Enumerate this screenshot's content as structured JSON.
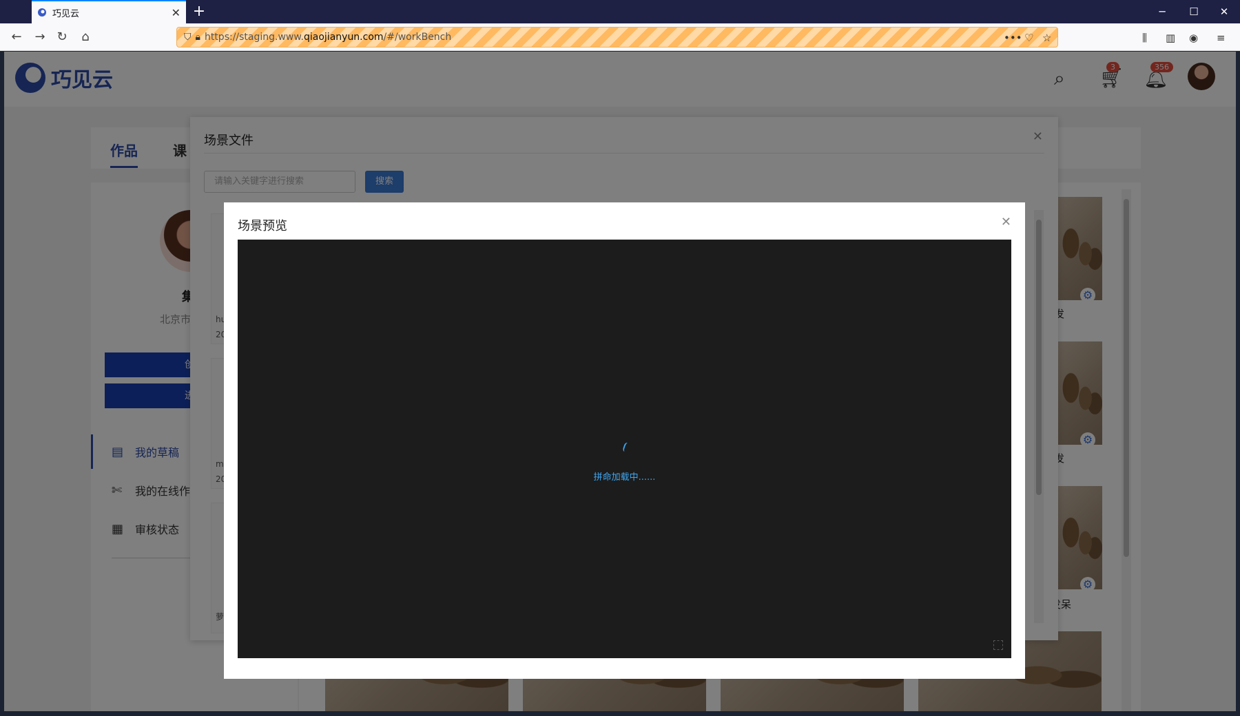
{
  "browser": {
    "tab_title": "巧见云",
    "new_tab": "+",
    "url_prefix": "https://staging.www.",
    "url_domain": "qiaojianyun.com",
    "url_path": "/#/workBench",
    "window_min": "─",
    "window_max": "☐",
    "window_close": "✕"
  },
  "app": {
    "logo_text": "巧见云",
    "cart_badge": "3",
    "bell_badge": "356",
    "tabs": {
      "works": "作品",
      "course": "课"
    },
    "profile": {
      "name": "集",
      "city": "北京市"
    },
    "buttons": {
      "create": "创作",
      "enter": "进入"
    },
    "menu": [
      {
        "label": "我的草稿"
      },
      {
        "label": "我的在线作品"
      },
      {
        "label": "审核状态"
      }
    ],
    "captions": [
      "发",
      "发",
      "里坐着发呆"
    ]
  },
  "scene_files_dialog": {
    "title": "场景文件",
    "search_placeholder": "请输入关键字进行搜索",
    "search_button": "搜索",
    "file_names": [
      "hu",
      "20",
      "m",
      "20",
      "萝"
    ]
  },
  "preview_dialog": {
    "title": "场景预览",
    "loading_text": "拼命加载中......"
  }
}
